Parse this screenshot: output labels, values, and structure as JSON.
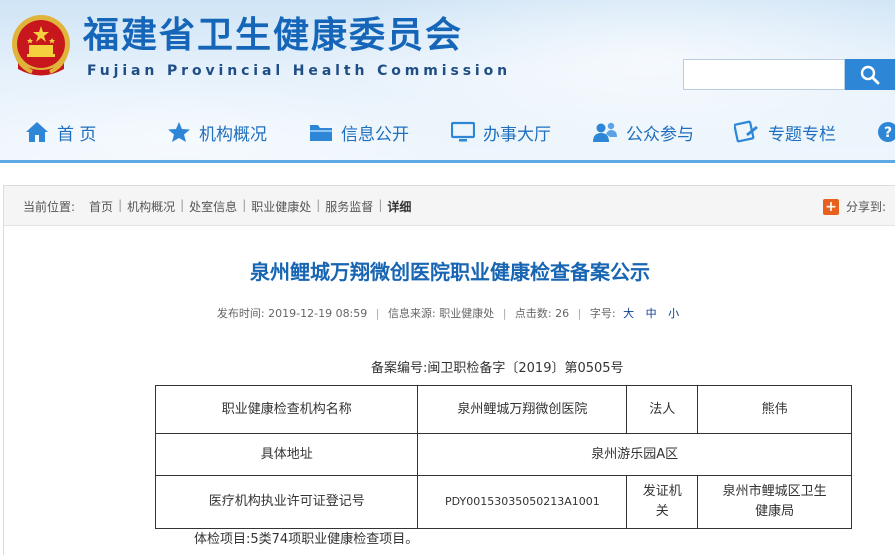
{
  "header": {
    "title": "福建省卫生健康委员会",
    "subtitle": "Fujian Provincial Health Commission",
    "search": {
      "value": "",
      "placeholder": ""
    }
  },
  "nav": [
    {
      "label": "首 页",
      "icon": "home-icon"
    },
    {
      "label": "机构概况",
      "icon": "star-icon"
    },
    {
      "label": "信息公开",
      "icon": "folder-icon"
    },
    {
      "label": "办事大厅",
      "icon": "monitor-icon"
    },
    {
      "label": "公众参与",
      "icon": "people-icon"
    },
    {
      "label": "专题专栏",
      "icon": "topic-icon"
    },
    {
      "label": "?",
      "icon": "help-icon"
    }
  ],
  "breadcrumb": {
    "prefix": "当前位置:",
    "items": [
      "首页",
      "机构概况",
      "处室信息",
      "职业健康处",
      "服务监督"
    ],
    "current": "详细"
  },
  "share": {
    "label": "分享到:"
  },
  "article": {
    "title": "泉州鲤城万翔微创医院职业健康检查备案公示",
    "meta": {
      "publish_label": "发布时间:",
      "publish_time": "2019-12-19 08:59",
      "source_label": "信息来源:",
      "source": "职业健康处",
      "clicks_label": "点击数:",
      "clicks": "26",
      "font_label": "字号:",
      "font_large": "大",
      "font_medium": "中",
      "font_small": "小"
    },
    "record_no": "备案编号:闽卫职检备字〔2019〕第0505号",
    "table": {
      "r1": {
        "c1": "职业健康检查机构名称",
        "c2": "泉州鲤城万翔微创医院",
        "c3": "法人",
        "c4": "熊伟"
      },
      "r2": {
        "c1": "具体地址",
        "c2": "泉州游乐园A区"
      },
      "r3": {
        "c1": "医疗机构执业许可证登记号",
        "c2": "PDY00153035050213A1001",
        "c3": "发证机关",
        "c4": "泉州市鲤城区卫生健康局"
      }
    },
    "paragraph": "体检项目:5类74项职业健康检查项目。"
  },
  "colors": {
    "brand_blue": "#1565b8",
    "accent_orange": "#e8601c",
    "nav_blue": "#1f6fbf"
  }
}
